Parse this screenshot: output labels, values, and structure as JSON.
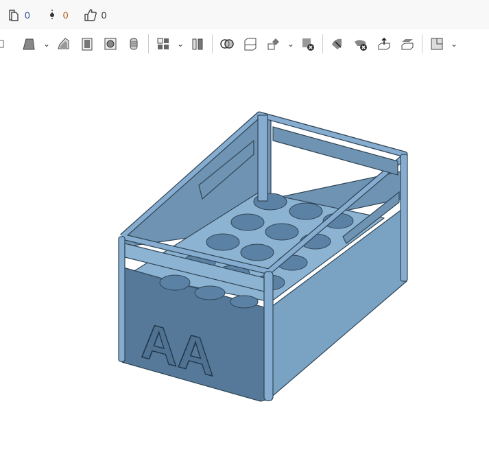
{
  "stats": {
    "copies": "0",
    "branches": "0",
    "likes": "0"
  },
  "model": {
    "emboss_text": "AA"
  },
  "colors": {
    "face_front": "#56799a",
    "face_side": "#7aa2c3",
    "floor": "#8db3d3",
    "hole": "#5b82a4",
    "edge": "#2f4556"
  }
}
